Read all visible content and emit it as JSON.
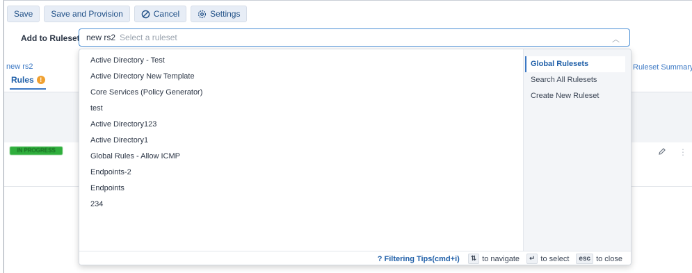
{
  "toolbar": {
    "save": "Save",
    "save_provision": "Save and Provision",
    "cancel": "Cancel",
    "settings": "Settings"
  },
  "ruleset": {
    "label": "Add to Ruleset",
    "token": "new rs2",
    "placeholder": "Select a ruleset"
  },
  "page": {
    "name": "new rs2",
    "tab_rules": "Rules",
    "tab_rules_badge": "!",
    "tab_summary": "Ruleset Summary",
    "status_pill": "IN PROGRESS"
  },
  "dropdown": {
    "options": [
      "Active Directory - Test",
      "Active Directory New Template",
      "Core Services (Policy Generator)",
      "test",
      "Active Directory123",
      "Active Directory1",
      "Global Rules - Allow ICMP",
      "Endpoints-2",
      "Endpoints",
      "234"
    ],
    "side": {
      "global": "Global Rulesets",
      "search_all": "Search All Rulesets",
      "create_new": "Create New Ruleset"
    },
    "footer": {
      "tips": "? Filtering Tips(cmd+i)",
      "nav_key": "⇅",
      "nav_text": "to navigate",
      "select_key": "↵",
      "select_text": "to select",
      "close_key": "esc",
      "close_text": "to close"
    }
  },
  "colors": {
    "accent": "#1f5fa8",
    "focus_border": "#4a8fd6",
    "status_green": "#2fae3c",
    "badge_orange": "#f0a030"
  }
}
